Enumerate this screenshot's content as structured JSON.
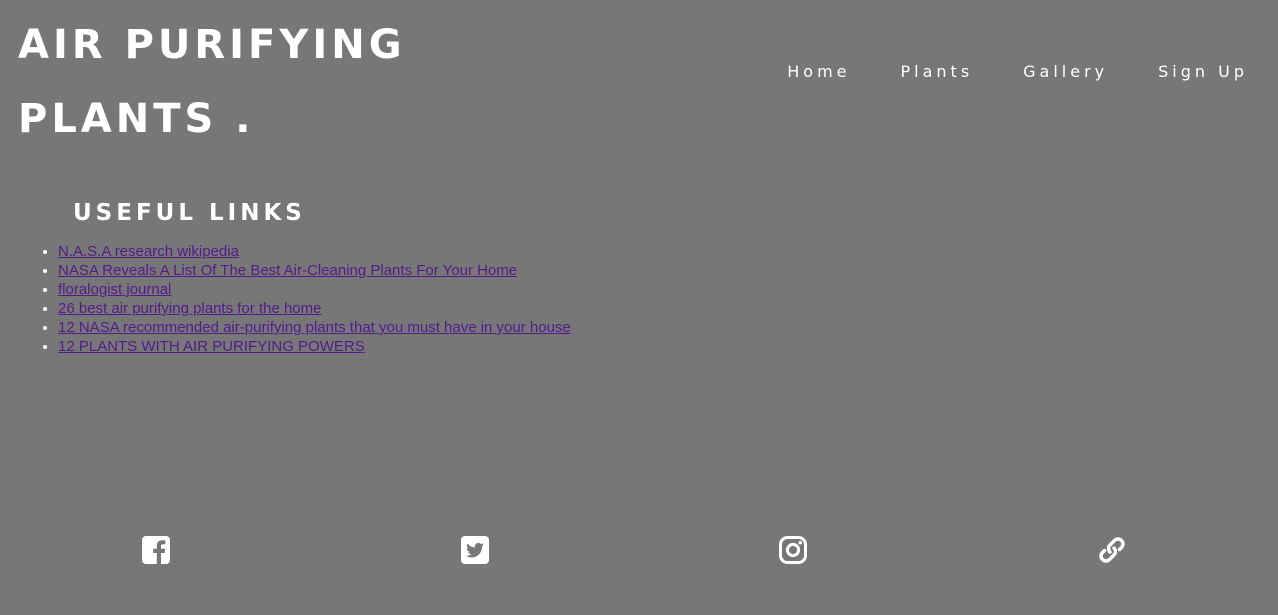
{
  "header": {
    "title_line1": "AIR PURIFYING",
    "title_line2": "PLANTS ."
  },
  "nav": {
    "items": [
      {
        "label": "Home"
      },
      {
        "label": "Plants"
      },
      {
        "label": "Gallery"
      },
      {
        "label": "Sign Up"
      }
    ]
  },
  "useful_links": {
    "heading": "USEFUL LINKS",
    "items": [
      {
        "label": "N.A.S.A research wikipedia"
      },
      {
        "label": "NASA Reveals A List Of The Best Air-Cleaning Plants For Your Home"
      },
      {
        "label": "floralogist journal"
      },
      {
        "label": "26 best air purifying plants for the home"
      },
      {
        "label": "12 NASA recommended air-purifying plants that you must have in your house"
      },
      {
        "label": "12 PLANTS WITH AIR PURIFYING POWERS"
      }
    ]
  },
  "social": {
    "icons": [
      "facebook-icon",
      "twitter-icon",
      "instagram-icon",
      "link-icon"
    ]
  },
  "colors": {
    "background": "#777777",
    "text": "#ffffff",
    "link": "#551a8b"
  }
}
